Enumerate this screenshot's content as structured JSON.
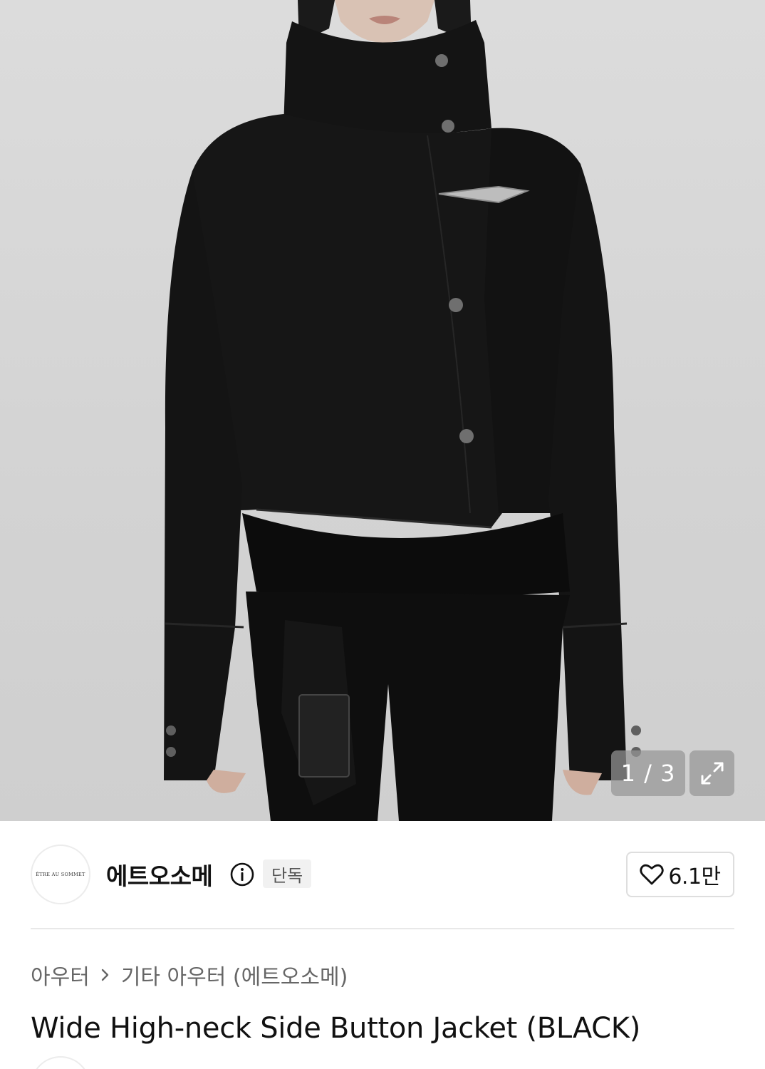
{
  "gallery": {
    "counter": "1 / 3",
    "expand_icon": "expand-arrows-icon"
  },
  "seller": {
    "logo_text": "ÊTRE AU SOMMET",
    "name": "에트오소메",
    "info_icon": "info-icon",
    "badge": "단독",
    "like_icon": "heart-icon",
    "like_count": "6.1만"
  },
  "breadcrumb": {
    "items": [
      "아우터",
      "기타 아우터 (에트오소메)"
    ],
    "separator_icon": "chevron-right-icon"
  },
  "product": {
    "title": "Wide High-neck Side Button Jacket (BLACK)"
  },
  "colors": {
    "text_primary": "#111111",
    "text_secondary": "#666666",
    "badge_bg": "#f1f1f1",
    "border": "#dedede"
  }
}
